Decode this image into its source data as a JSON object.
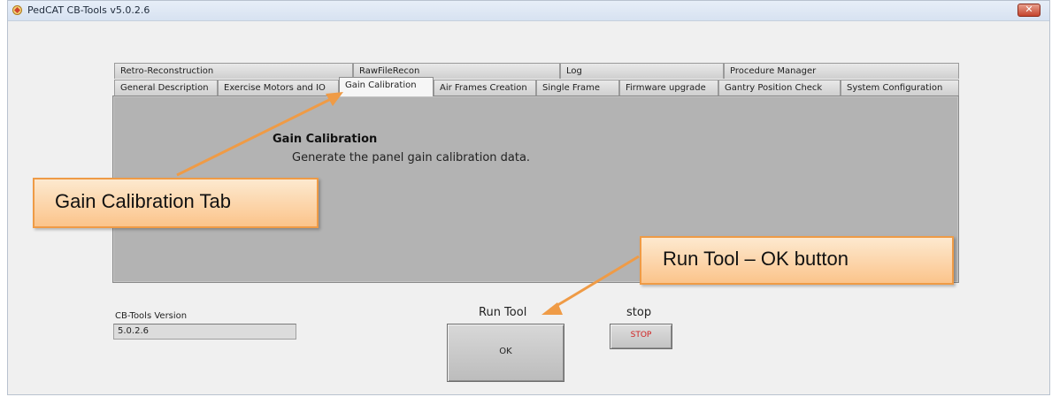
{
  "window": {
    "title": "PedCAT CB-Tools v5.0.2.6",
    "close_label": "✕"
  },
  "tabs": {
    "row_back": [
      {
        "label": "Retro-Reconstruction"
      },
      {
        "label": "RawFileRecon"
      },
      {
        "label": "Log"
      },
      {
        "label": "Procedure Manager"
      }
    ],
    "row_front": [
      {
        "label": "General Description"
      },
      {
        "label": "Exercise Motors and IO"
      },
      {
        "label": "Gain Calibration",
        "active": true
      },
      {
        "label": "Air Frames Creation"
      },
      {
        "label": "Single Frame"
      },
      {
        "label": "Firmware upgrade"
      },
      {
        "label": "Gantry Position Check"
      },
      {
        "label": "System Configuration"
      }
    ]
  },
  "panel": {
    "heading": "Gain Calibration",
    "description": "Generate the panel gain calibration data."
  },
  "version": {
    "label": "CB-Tools Version",
    "value": "5.0.2.6"
  },
  "run_tool": {
    "label": "Run Tool",
    "button_label": "OK"
  },
  "stop": {
    "label": "stop",
    "button_label": "STOP"
  },
  "callouts": {
    "gain_tab": "Gain Calibration Tab",
    "ok_button": "Run Tool – OK button"
  },
  "colors": {
    "panel_gray": "#b3b3b3",
    "callout_fill": "#fbc48b",
    "callout_border": "#ef9b46",
    "stop_text": "#d02020"
  }
}
